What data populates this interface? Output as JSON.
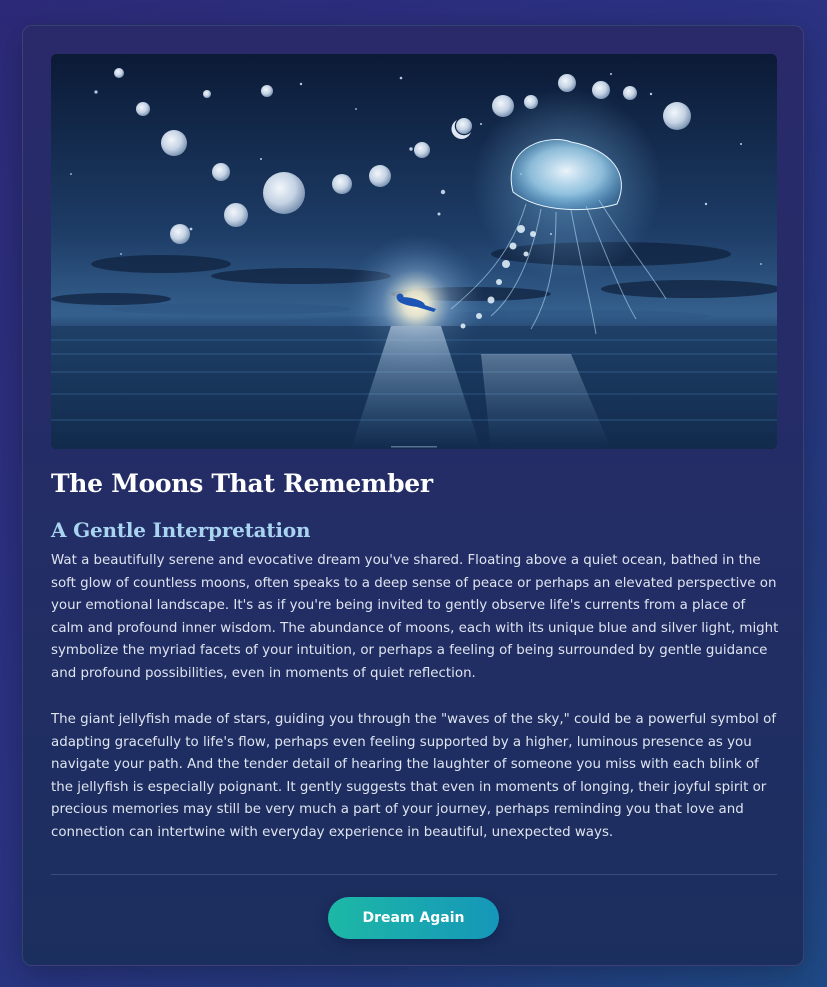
{
  "hero": {
    "alt": "A glowing star jellyfish guiding a floating figure above a calm ocean under many moons"
  },
  "title": "The Moons That Remember",
  "interpretation": {
    "heading": "A Gentle Interpretation",
    "paragraphs": [
      "Wat a beautifully serene and evocative dream you've shared. Floating above a quiet ocean, bathed in the soft glow of countless moons, often speaks to a deep sense of peace or perhaps an elevated perspective on your emotional landscape. It's as if you're being invited to gently observe life's currents from a place of calm and profound inner wisdom. The abundance of moons, each with its unique blue and silver light, might symbolize the myriad facets of your intuition, or perhaps a feeling of being surrounded by gentle guidance and profound possibilities, even in moments of quiet reflection.",
      "The giant jellyfish made of stars, guiding you through the \"waves of the sky,\" could be a powerful symbol of adapting gracefully to life's flow, perhaps even feeling supported by a higher, luminous presence as you navigate your path. And the tender detail of hearing the laughter of someone you miss with each blink of the jellyfish is especially poignant. It gently suggests that even in moments of longing, their joyful spirit or precious memories may still be very much a part of your journey, perhaps reminding you that love and connection can intertwine with everyday experience in beautiful, unexpected ways."
    ]
  },
  "actions": {
    "dream_again_label": "Dream Again"
  },
  "colors": {
    "accent_start": "#1db8a6",
    "accent_end": "#1597b9",
    "heading": "#ffffff",
    "subheading": "#a8d4f0"
  }
}
